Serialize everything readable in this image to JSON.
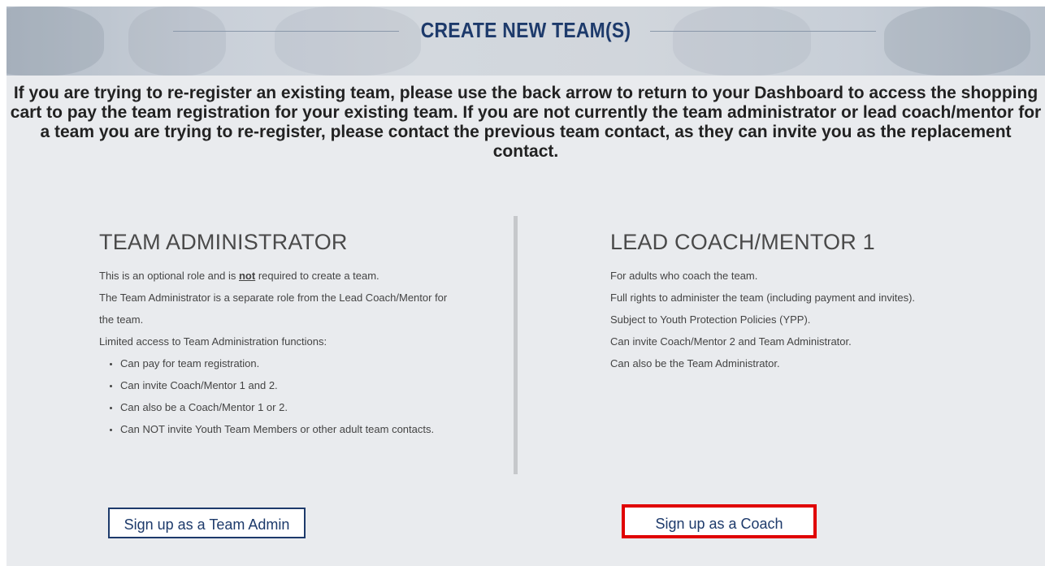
{
  "header": {
    "title": "CREATE NEW TEAM(S)"
  },
  "notice": {
    "text": "If you are trying to re-register an existing team, please use the back arrow to return to your Dashboard to access the shopping cart to pay the team registration for your existing team. If you are not currently the team administrator or lead coach/mentor for a team you are trying to re-register, please contact the previous team contact, as they can invite you as the replacement contact."
  },
  "admin": {
    "title": "TEAM ADMINISTRATOR",
    "line1_prefix": "This is an optional role and is ",
    "line1_emph": "not",
    "line1_suffix": " required to create a team.",
    "line2": "The Team Administrator is a separate role from the Lead Coach/Mentor for",
    "line3": "the team.",
    "line4": "Limited access to Team Administration functions:",
    "bullets": [
      "Can pay for team registration.",
      "Can invite Coach/Mentor 1 and 2.",
      "Can also be a Coach/Mentor 1 or 2.",
      "Can NOT invite Youth Team Members or other adult team contacts."
    ],
    "button_label": "Sign up as a Team Admin"
  },
  "coach": {
    "title": "LEAD COACH/MENTOR 1",
    "lines": [
      "For adults who coach the team.",
      "Full rights to administer the team (including payment and invites).",
      "Subject to Youth Protection Policies (YPP).",
      "Can invite Coach/Mentor 2 and Team Administrator.",
      "Can also be the Team Administrator."
    ],
    "button_label": "Sign up as a Coach"
  },
  "colors": {
    "brand_navy": "#1d3a6b",
    "highlight_red": "#e00000",
    "panel_bg": "#e9ebee"
  }
}
